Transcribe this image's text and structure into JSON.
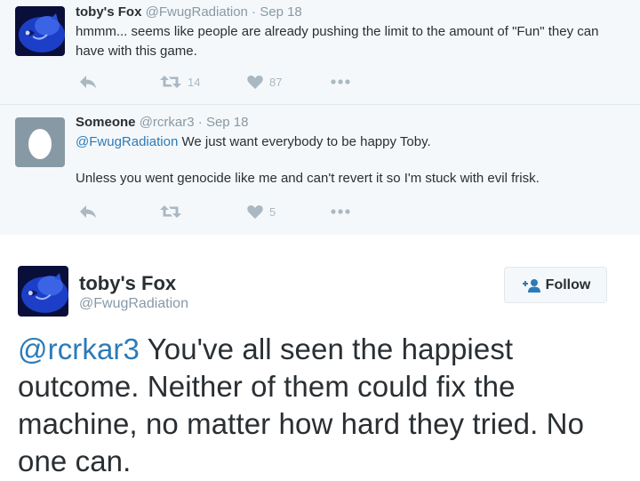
{
  "thread": [
    {
      "name": "toby's Fox",
      "handle": "@FwugRadiation",
      "sep": " · ",
      "date": "Sep 18",
      "text_lines": [
        "hmmm... seems like people are already pushing the limit to the amount of \"Fun\" they can have with this game."
      ],
      "retweets": "14",
      "likes": "87",
      "avatar_icon": "blue-cartoon-avatar"
    },
    {
      "name": "Someone",
      "handle": "@rcrkar3",
      "sep": " · ",
      "date": "Sep 18",
      "mention": "@FwugRadiation",
      "text_after_mention": " We just want everybody to be happy Toby.",
      "text_second_paragraph": "Unless you went genocide like me and can't revert it so I'm stuck with evil frisk.",
      "retweets": "",
      "likes": "5",
      "avatar_icon": "default-egg-avatar"
    }
  ],
  "main_tweet": {
    "name": "toby's Fox",
    "handle": "@FwugRadiation",
    "follow_label": "Follow",
    "mention": "@rcrkar3",
    "text": " You've all seen the happiest outcome. Neither of them could fix the machine, no matter how hard they tried. No one can.",
    "avatar_icon": "blue-cartoon-avatar"
  },
  "colors": {
    "link": "#2b7bb9",
    "muted": "#8899a6",
    "icon_gray": "#aab8c2",
    "text": "#292f33",
    "thread_bg": "#f5f8fa",
    "avatar_blue": "#1d3fc7",
    "egg_bg": "#8899a6"
  }
}
